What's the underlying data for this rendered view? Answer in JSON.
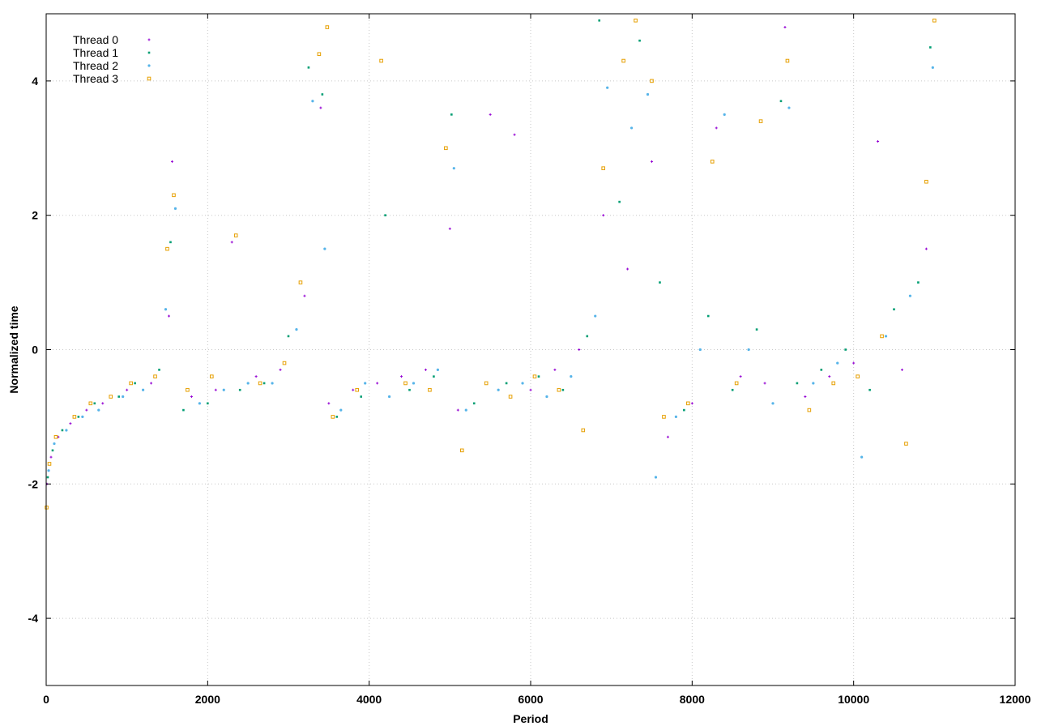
{
  "chart_data": {
    "type": "scatter",
    "title": "",
    "xlabel": "Period",
    "ylabel": "Normalized time",
    "xlim": [
      0,
      12000
    ],
    "ylim": [
      -5,
      5
    ],
    "xticks": [
      0,
      2000,
      4000,
      6000,
      8000,
      10000,
      12000
    ],
    "yticks": [
      -4,
      -2,
      0,
      2,
      4
    ],
    "grid": true,
    "legend_position": "top-left",
    "series": [
      {
        "name": "Thread 0",
        "color": "#9400d3",
        "marker": "plus",
        "points": [
          [
            10,
            -2.0
          ],
          [
            60,
            -1.6
          ],
          [
            150,
            -1.3
          ],
          [
            300,
            -1.1
          ],
          [
            500,
            -0.9
          ],
          [
            700,
            -0.8
          ],
          [
            1000,
            -0.6
          ],
          [
            1300,
            -0.5
          ],
          [
            1520,
            0.5
          ],
          [
            1560,
            2.8
          ],
          [
            1800,
            -0.7
          ],
          [
            2100,
            -0.6
          ],
          [
            2300,
            1.6
          ],
          [
            2600,
            -0.4
          ],
          [
            2900,
            -0.3
          ],
          [
            3200,
            0.8
          ],
          [
            3400,
            3.6
          ],
          [
            3500,
            -0.8
          ],
          [
            3800,
            -0.6
          ],
          [
            4100,
            -0.5
          ],
          [
            4400,
            -0.4
          ],
          [
            4700,
            -0.3
          ],
          [
            5000,
            1.8
          ],
          [
            5100,
            -0.9
          ],
          [
            5500,
            3.5
          ],
          [
            5800,
            3.2
          ],
          [
            6000,
            -0.6
          ],
          [
            6300,
            -0.3
          ],
          [
            6600,
            0.0
          ],
          [
            6900,
            2.0
          ],
          [
            7200,
            1.2
          ],
          [
            7500,
            2.8
          ],
          [
            7700,
            -1.3
          ],
          [
            8000,
            -0.8
          ],
          [
            8300,
            3.3
          ],
          [
            8600,
            -0.4
          ],
          [
            8900,
            -0.5
          ],
          [
            9150,
            4.8
          ],
          [
            9400,
            -0.7
          ],
          [
            9700,
            -0.4
          ],
          [
            10000,
            -0.2
          ],
          [
            10300,
            3.1
          ],
          [
            10600,
            -0.3
          ],
          [
            10900,
            1.5
          ]
        ]
      },
      {
        "name": "Thread 1",
        "color": "#009e73",
        "marker": "square-small",
        "points": [
          [
            20,
            -1.9
          ],
          [
            80,
            -1.5
          ],
          [
            200,
            -1.2
          ],
          [
            400,
            -1.0
          ],
          [
            600,
            -0.8
          ],
          [
            900,
            -0.7
          ],
          [
            1100,
            -0.5
          ],
          [
            1400,
            -0.3
          ],
          [
            1540,
            1.6
          ],
          [
            1700,
            -0.9
          ],
          [
            2000,
            -0.8
          ],
          [
            2400,
            -0.6
          ],
          [
            2700,
            -0.5
          ],
          [
            3000,
            0.2
          ],
          [
            3250,
            4.2
          ],
          [
            3420,
            3.8
          ],
          [
            3600,
            -1.0
          ],
          [
            3900,
            -0.7
          ],
          [
            4200,
            2.0
          ],
          [
            4500,
            -0.6
          ],
          [
            4800,
            -0.4
          ],
          [
            5020,
            3.5
          ],
          [
            5300,
            -0.8
          ],
          [
            5700,
            -0.5
          ],
          [
            6100,
            -0.4
          ],
          [
            6400,
            -0.6
          ],
          [
            6700,
            0.2
          ],
          [
            6850,
            4.9
          ],
          [
            7100,
            2.2
          ],
          [
            7350,
            4.6
          ],
          [
            7600,
            1.0
          ],
          [
            7900,
            -0.9
          ],
          [
            8200,
            0.5
          ],
          [
            8500,
            -0.6
          ],
          [
            8800,
            0.3
          ],
          [
            9100,
            3.7
          ],
          [
            9300,
            -0.5
          ],
          [
            9600,
            -0.3
          ],
          [
            9900,
            0.0
          ],
          [
            10200,
            -0.6
          ],
          [
            10500,
            0.6
          ],
          [
            10800,
            1.0
          ],
          [
            10950,
            4.5
          ]
        ]
      },
      {
        "name": "Thread 2",
        "color": "#56b4e9",
        "marker": "circle-small",
        "points": [
          [
            30,
            -1.8
          ],
          [
            100,
            -1.4
          ],
          [
            250,
            -1.2
          ],
          [
            450,
            -1.0
          ],
          [
            650,
            -0.9
          ],
          [
            950,
            -0.7
          ],
          [
            1200,
            -0.6
          ],
          [
            1480,
            0.6
          ],
          [
            1600,
            2.1
          ],
          [
            1900,
            -0.8
          ],
          [
            2200,
            -0.6
          ],
          [
            2500,
            -0.5
          ],
          [
            2800,
            -0.5
          ],
          [
            3100,
            0.3
          ],
          [
            3300,
            3.7
          ],
          [
            3450,
            1.5
          ],
          [
            3650,
            -0.9
          ],
          [
            3950,
            -0.5
          ],
          [
            4250,
            -0.7
          ],
          [
            4550,
            -0.5
          ],
          [
            4850,
            -0.3
          ],
          [
            5050,
            2.7
          ],
          [
            5200,
            -0.9
          ],
          [
            5600,
            -0.6
          ],
          [
            5900,
            -0.5
          ],
          [
            6200,
            -0.7
          ],
          [
            6500,
            -0.4
          ],
          [
            6800,
            0.5
          ],
          [
            6950,
            3.9
          ],
          [
            7250,
            3.3
          ],
          [
            7450,
            3.8
          ],
          [
            7550,
            -1.9
          ],
          [
            7800,
            -1.0
          ],
          [
            8100,
            0.0
          ],
          [
            8400,
            3.5
          ],
          [
            8700,
            0.0
          ],
          [
            9000,
            -0.8
          ],
          [
            9200,
            3.6
          ],
          [
            9500,
            -0.5
          ],
          [
            9800,
            -0.2
          ],
          [
            10100,
            -1.6
          ],
          [
            10400,
            0.2
          ],
          [
            10700,
            0.8
          ],
          [
            10980,
            4.2
          ]
        ]
      },
      {
        "name": "Thread 3",
        "color": "#e69f00",
        "marker": "square",
        "points": [
          [
            5,
            -2.35
          ],
          [
            40,
            -1.7
          ],
          [
            120,
            -1.3
          ],
          [
            350,
            -1.0
          ],
          [
            550,
            -0.8
          ],
          [
            800,
            -0.7
          ],
          [
            1050,
            -0.5
          ],
          [
            1350,
            -0.4
          ],
          [
            1500,
            1.5
          ],
          [
            1580,
            2.3
          ],
          [
            1750,
            -0.6
          ],
          [
            2050,
            -0.4
          ],
          [
            2350,
            1.7
          ],
          [
            2650,
            -0.5
          ],
          [
            2950,
            -0.2
          ],
          [
            3150,
            1.0
          ],
          [
            3380,
            4.4
          ],
          [
            3480,
            4.8
          ],
          [
            3550,
            -1.0
          ],
          [
            3850,
            -0.6
          ],
          [
            4150,
            4.3
          ],
          [
            4450,
            -0.5
          ],
          [
            4750,
            -0.6
          ],
          [
            4950,
            3.0
          ],
          [
            5150,
            -1.5
          ],
          [
            5450,
            -0.5
          ],
          [
            5750,
            -0.7
          ],
          [
            6050,
            -0.4
          ],
          [
            6350,
            -0.6
          ],
          [
            6650,
            -1.2
          ],
          [
            6900,
            2.7
          ],
          [
            7150,
            4.3
          ],
          [
            7300,
            4.9
          ],
          [
            7500,
            4.0
          ],
          [
            7650,
            -1.0
          ],
          [
            7950,
            -0.8
          ],
          [
            8250,
            2.8
          ],
          [
            8550,
            -0.5
          ],
          [
            8850,
            3.4
          ],
          [
            9180,
            4.3
          ],
          [
            9450,
            -0.9
          ],
          [
            9750,
            -0.5
          ],
          [
            10050,
            -0.4
          ],
          [
            10350,
            0.2
          ],
          [
            10650,
            -1.4
          ],
          [
            10900,
            2.5
          ],
          [
            11000,
            4.9
          ]
        ]
      }
    ]
  }
}
